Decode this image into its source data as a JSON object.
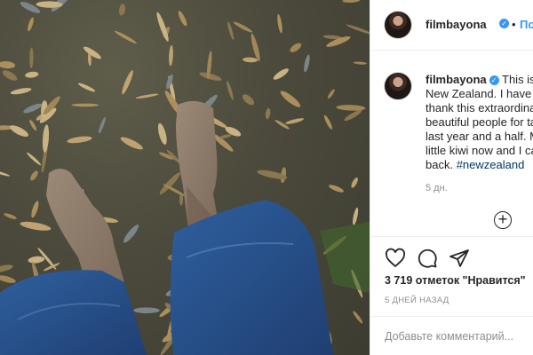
{
  "post": {
    "photo_alt_icon": "photo-of-bare-feet-on-leafy-ground"
  },
  "header": {
    "username": "filmbayona",
    "separator": "•",
    "follow_label": "Подп"
  },
  "caption": {
    "username": "filmbayona",
    "lines": [
      "This is m",
      "New Zealand. I have n",
      "thank this extraordina",
      "beautiful people for ta",
      "last year and a half. M",
      "little kiwi now and I ca",
      "back."
    ],
    "hashtag": "#newzealand",
    "age": "5 дн."
  },
  "actions": {
    "icons": [
      "heart-icon",
      "comment-icon",
      "share-icon"
    ],
    "likes": "3 719 отметок \"Нравится\"",
    "timestamp": "5 ДНЕЙ НАЗАД"
  },
  "comment": {
    "placeholder": "Добавьте комментарий..."
  },
  "colors": {
    "accent": "#3897f0",
    "text": "#262626",
    "muted": "#8e8e8e",
    "hashtag": "#00376b"
  }
}
